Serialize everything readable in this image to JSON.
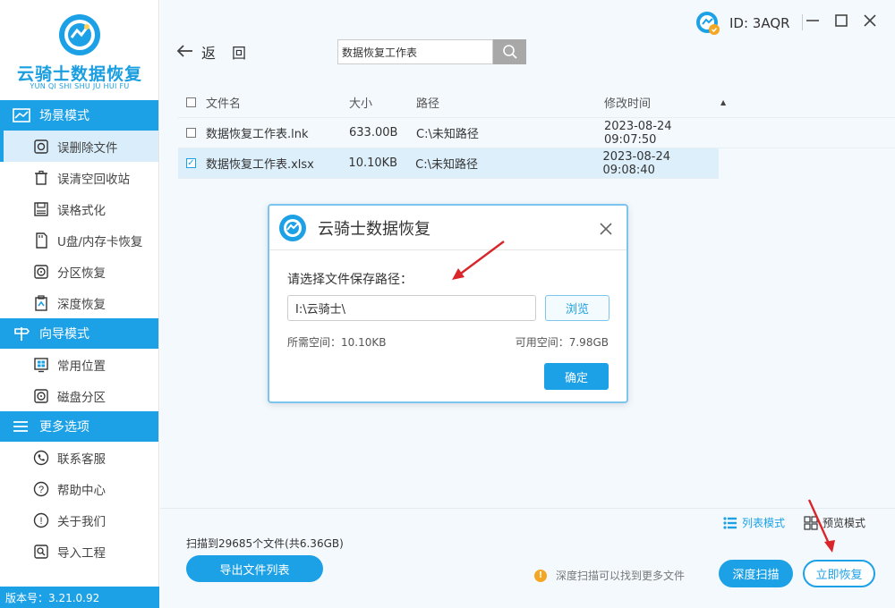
{
  "app": {
    "name": "云骑士数据恢复",
    "name_sub": "YUN QI SHI SHU JU HUI FU",
    "version": "版本号：3.21.0.92",
    "user_id": "ID: 3AQR"
  },
  "sidebar": {
    "sections": [
      {
        "label": "场景模式",
        "icon": "chart-icon",
        "items": [
          {
            "label": "误删除文件",
            "icon": "file-restore-icon",
            "active": true
          },
          {
            "label": "误清空回收站",
            "icon": "recycle-bin-icon",
            "active": false
          },
          {
            "label": "误格式化",
            "icon": "format-disk-icon",
            "active": false
          },
          {
            "label": "U盘/内存卡恢复",
            "icon": "sd-card-icon",
            "active": false
          },
          {
            "label": "分区恢复",
            "icon": "partition-icon",
            "active": false
          },
          {
            "label": "深度恢复",
            "icon": "deep-recover-icon",
            "active": false
          }
        ]
      },
      {
        "label": "向导模式",
        "icon": "signpost-icon",
        "items": [
          {
            "label": "常用位置",
            "icon": "windows-icon",
            "active": false
          },
          {
            "label": "磁盘分区",
            "icon": "disk-icon",
            "active": false
          }
        ]
      },
      {
        "label": "更多选项",
        "icon": "menu-icon",
        "items": [
          {
            "label": "联系客服",
            "icon": "phone-icon",
            "active": false
          },
          {
            "label": "帮助中心",
            "icon": "help-icon",
            "active": false
          },
          {
            "label": "关于我们",
            "icon": "info-icon",
            "active": false
          },
          {
            "label": "导入工程",
            "icon": "import-icon",
            "active": false
          }
        ]
      }
    ]
  },
  "toolbar": {
    "back_label": "返回",
    "search_value": "数据恢复工作表"
  },
  "table": {
    "headers": {
      "name": "文件名",
      "size": "大小",
      "path": "路径",
      "time": "修改时间"
    },
    "rows": [
      {
        "name": "数据恢复工作表.lnk",
        "size": "633.00B",
        "path": "C:\\未知路径",
        "time": "2023-08-24 09:07:50",
        "checked": false
      },
      {
        "name": "数据恢复工作表.xlsx",
        "size": "10.10KB",
        "path": "C:\\未知路径",
        "time": "2023-08-24 09:08:40",
        "checked": true
      }
    ]
  },
  "dialog": {
    "title": "云骑士数据恢复",
    "prompt": "请选择文件保存路径：",
    "path_value": "I:\\云骑士\\",
    "browse_label": "浏览",
    "required_space": "所需空间：10.10KB",
    "available_space": "可用空间：7.98GB",
    "ok_label": "确定"
  },
  "footer": {
    "view_list_label": "列表模式",
    "view_preview_label": "预览模式",
    "scan_summary": "扫描到29685个文件(共6.36GB)",
    "export_label": "导出文件列表",
    "hint_text": "深度扫描可以找到更多文件",
    "deep_scan_label": "深度扫描",
    "recover_label": "立即恢复"
  },
  "colors": {
    "accent": "#1da1e6",
    "active_bg": "#d9eefa",
    "warning": "#f5a623",
    "annotation_arrow": "#d9262b"
  }
}
